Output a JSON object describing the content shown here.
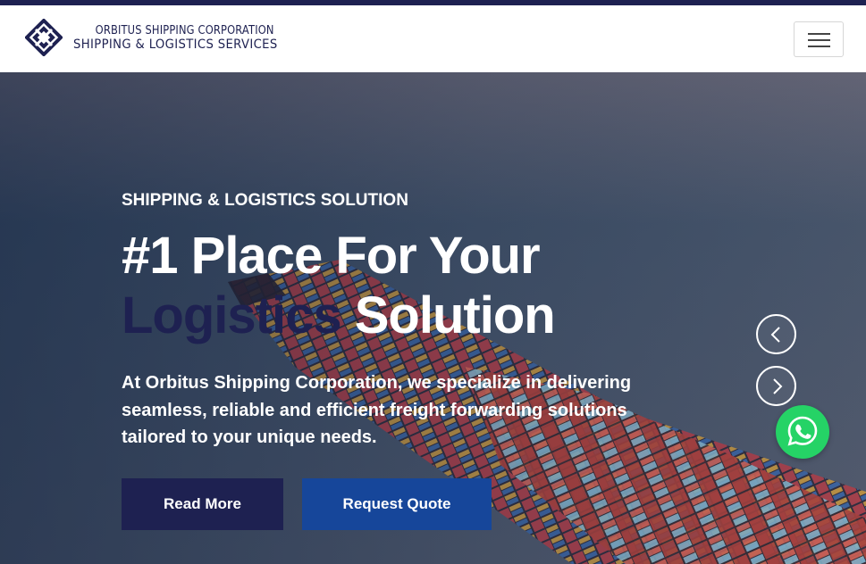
{
  "header": {
    "brand_name": "ORBITUS SHIPPING CORPORATION",
    "brand_tagline": "SHIPPING & LOGISTICS SERVICES",
    "logo_icon": "orbitus-diamond-logo",
    "menu_icon": "hamburger-icon"
  },
  "hero": {
    "subtitle": "SHIPPING & LOGISTICS SOLUTION",
    "headline_line1": "#1 Place For Your",
    "headline_highlight": "Logistics",
    "headline_end": "Solution",
    "description": "At Orbitus Shipping Corporation, we specialize in delivering seamless, reliable and efficient freight forwarding solutions tailored to your unique needs.",
    "primary_button": "Read More",
    "secondary_button": "Request Quote",
    "background": "container-ship-at-sea"
  },
  "carousel": {
    "prev_icon": "chevron-left-icon",
    "next_icon": "chevron-right-icon"
  },
  "floating": {
    "whatsapp_icon": "whatsapp-icon"
  },
  "colors": {
    "top_bar": "#1e2151",
    "brand_navy": "#1e2151",
    "primary_button": "#1e2151",
    "secondary_button": "#16469a",
    "whatsapp": "#25d366",
    "sea": "#33465a"
  }
}
